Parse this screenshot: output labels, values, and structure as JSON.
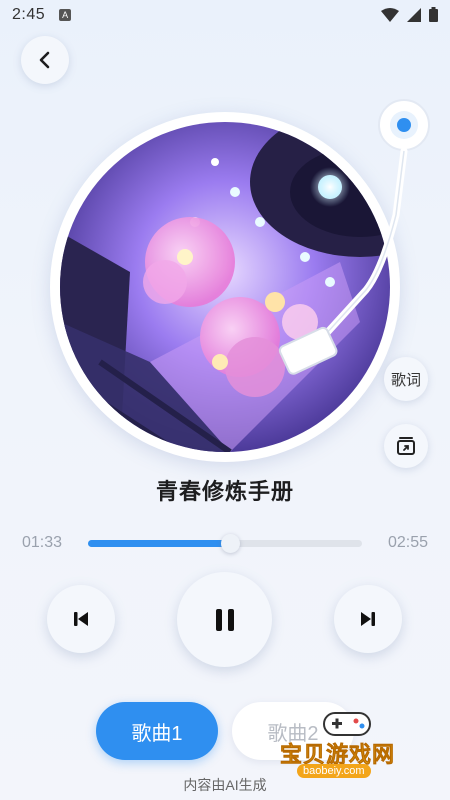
{
  "status_bar": {
    "time": "2:45",
    "notification_icon_letter": "A",
    "icons": [
      "wifi-icon",
      "signal-icon",
      "battery-icon"
    ]
  },
  "header": {
    "back_icon": "chevron-left-icon"
  },
  "player": {
    "song_title": "青春修炼手册",
    "lyrics_label": "歌词",
    "share_icon": "share-card-icon",
    "current_time": "01:33",
    "total_time": "02:55",
    "progress_fraction": 0.52,
    "accent_color": "#2f8ff0"
  },
  "controls": {
    "prev_icon": "skip-previous-icon",
    "play_icon": "pause-icon",
    "next_icon": "skip-next-icon"
  },
  "songs": [
    {
      "label": "歌曲1",
      "active": true
    },
    {
      "label": "歌曲2",
      "active": false
    }
  ],
  "footer": {
    "ai_note": "内容由AI生成"
  },
  "watermark": {
    "title": "宝贝游戏网",
    "url": "baobeiy.com"
  }
}
